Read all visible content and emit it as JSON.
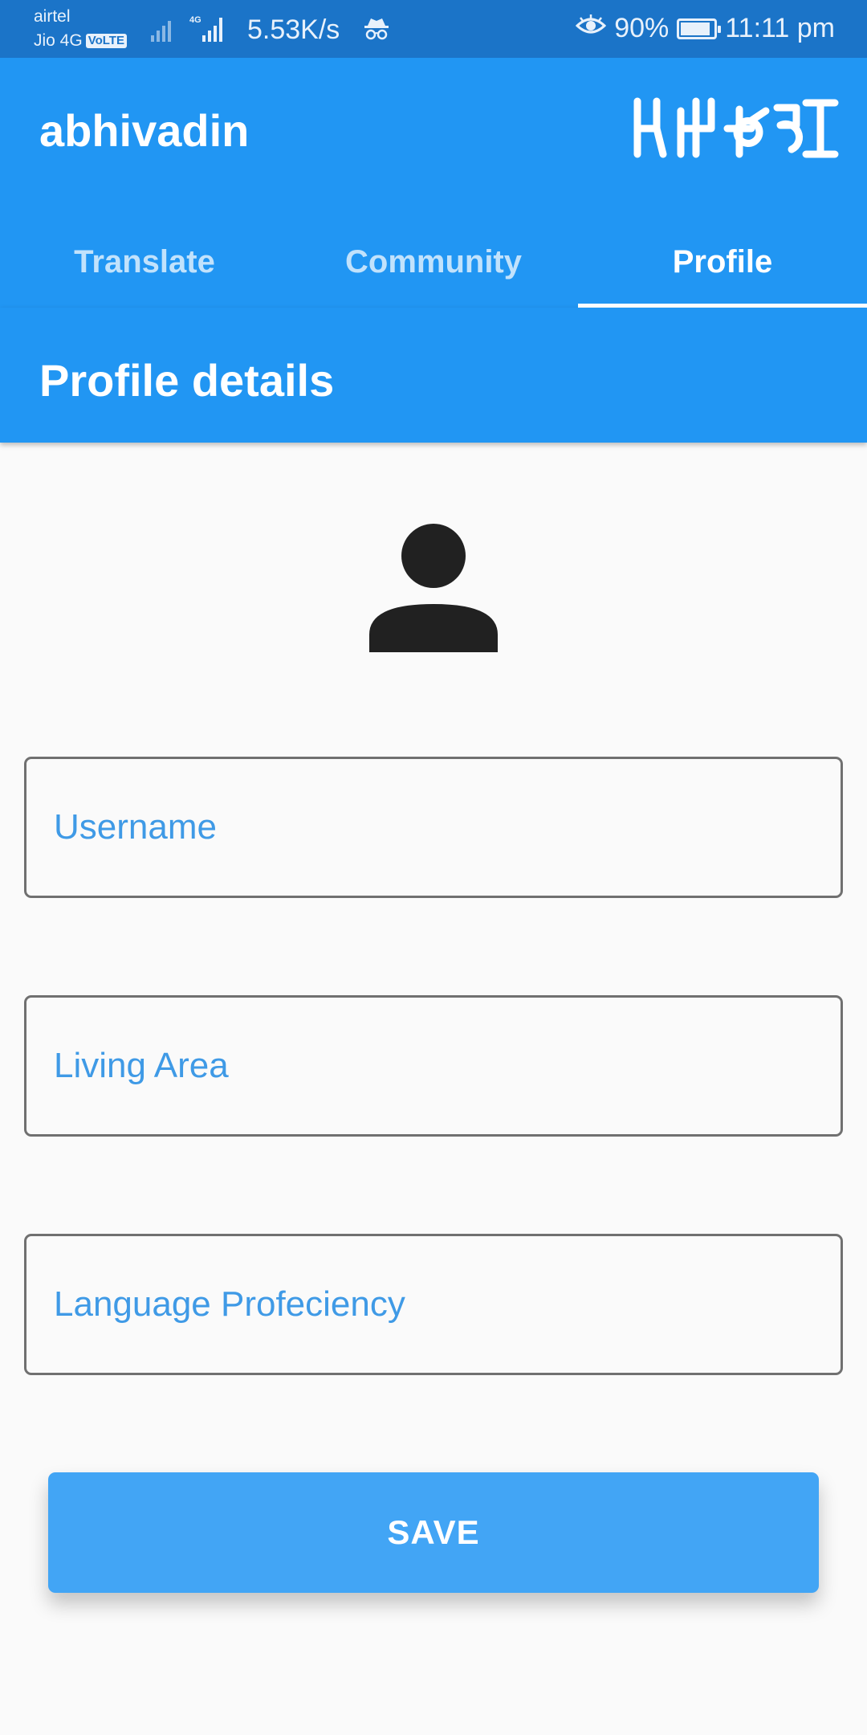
{
  "status_bar": {
    "carrier_1": "airtel",
    "carrier_2": "Jio 4G",
    "volte": "VoLTE",
    "net_type": "4G",
    "speed": "5.53K/s",
    "battery": "90%",
    "battery_level": 0.9,
    "time": "11:11 pm",
    "icons": [
      "signal-icon",
      "incognito-icon",
      "eye-icon",
      "battery-icon"
    ]
  },
  "app_bar": {
    "title": "abhivadin",
    "logo_text": "अभिवादन"
  },
  "tabs": [
    {
      "label": "Translate",
      "active": false
    },
    {
      "label": "Community",
      "active": false
    },
    {
      "label": "Profile",
      "active": true
    }
  ],
  "section": {
    "title": "Profile details"
  },
  "form": {
    "avatar_icon": "person-icon",
    "username": {
      "value": "",
      "placeholder": "Username"
    },
    "living_area": {
      "value": "",
      "placeholder": "Living Area"
    },
    "language_proficiency": {
      "value": "",
      "placeholder": "Language Profeciency"
    },
    "save_label": "SAVE"
  },
  "colors": {
    "primary": "#2196f3",
    "status_bar": "#1b74c8",
    "button": "#42a5f5",
    "placeholder": "#3f9ae6"
  }
}
